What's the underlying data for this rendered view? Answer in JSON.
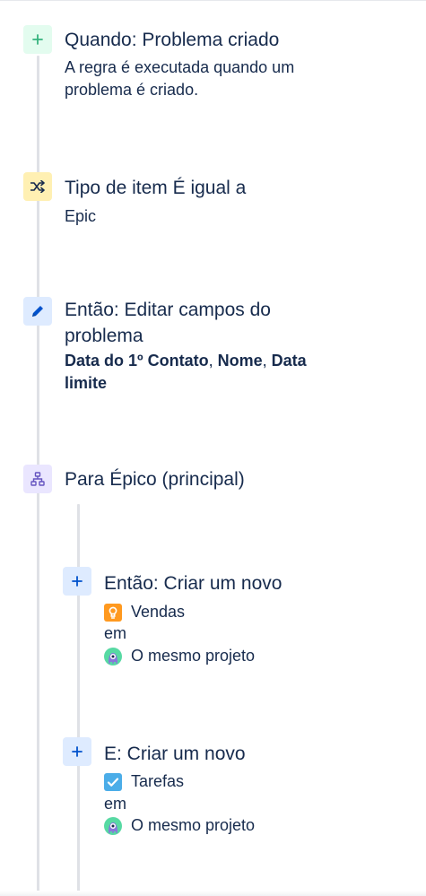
{
  "steps": {
    "trigger": {
      "title": "Quando: Problema criado",
      "description_line1": "A regra é executada quando um",
      "description_line2": "problema é criado.",
      "icon": "plus-icon",
      "color": "#36b37e"
    },
    "condition": {
      "title": "Tipo de item É igual a",
      "value": "Epic",
      "icon": "shuffle-icon",
      "color": "#ff991f"
    },
    "edit_action": {
      "title_line1": "Então: Editar campos do",
      "title_line2": "problema",
      "field1": "Data do 1º Contato",
      "sep1": ",",
      "field2": "Nome",
      "sep2": ",",
      "field3_part1": "Data",
      "field3_part2": "limite",
      "icon": "pencil-icon",
      "color": "#0052cc"
    },
    "branch": {
      "title": "Para Épico (principal)",
      "icon": "hierarchy-icon",
      "color": "#6554c0"
    },
    "create1": {
      "title": "Então: Criar um novo",
      "issue_type": "Vendas",
      "issue_type_icon": "lightbulb-icon",
      "issue_type_color": "#ff991f",
      "preposition": "em",
      "project": "O mesmo projeto",
      "project_icon": "project-avatar-icon",
      "icon": "plus-icon",
      "color": "#0052cc"
    },
    "create2": {
      "title": "E: Criar um novo",
      "issue_type": "Tarefas",
      "issue_type_icon": "checkbox-icon",
      "issue_type_color": "#4bade8",
      "preposition": "em",
      "project": "O mesmo projeto",
      "project_icon": "project-avatar-icon",
      "icon": "plus-icon",
      "color": "#0052cc"
    }
  }
}
